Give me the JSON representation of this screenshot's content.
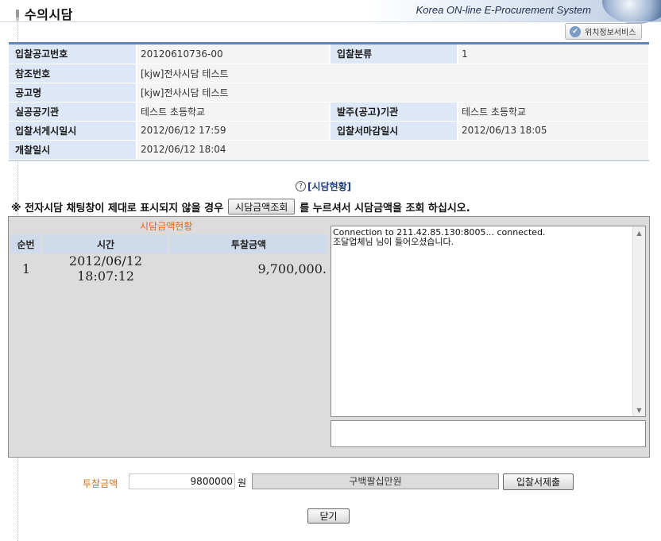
{
  "header": {
    "title": "수의시담",
    "brand": "Korea ON-line E-Procurement System",
    "location_button": "위치정보서비스"
  },
  "info": {
    "rows": [
      {
        "label1": "입찰공고번호",
        "value1": "20120610736-00",
        "label2": "입찰분류",
        "value2": "1"
      },
      {
        "label1": "참조번호",
        "value1": "[kjw]전사시담 테스트"
      },
      {
        "label1": "공고명",
        "value1": "[kjw]전사시담 테스트"
      },
      {
        "label1": "실공공기관",
        "value1": "테스트 초등학교",
        "label2": "발주(공고)기관",
        "value2": "테스트 초등학교"
      },
      {
        "label1": "입찰서게시일시",
        "value1": "2012/06/12 17:59",
        "label2": "입찰서마감일시",
        "value2": "2012/06/13 18:05"
      },
      {
        "label1": "개찰일시",
        "value1": "2012/06/12 18:04"
      }
    ]
  },
  "status_link": "[시담현황]",
  "notice": {
    "prefix": "※ 전자시담 채팅창이 제대로 표시되지 않을 경우",
    "button": "시담금액조회",
    "suffix": "를 누르셔서 시담금액을 조회 하십시오."
  },
  "bid_panel": {
    "caption": "시담금액현황",
    "columns": [
      "순번",
      "시간",
      "투찰금액"
    ],
    "rows": [
      {
        "seq": "1",
        "time": "2012/06/12 18:07:12",
        "amount": "9,700,000."
      }
    ]
  },
  "chat": {
    "lines": [
      "Connection to 211.42.85.130:8005... connected.",
      "조달업체님 님이 들어오셨습니다."
    ],
    "input": ""
  },
  "form": {
    "amount_label": "투찰금액",
    "amount_value": "9800000",
    "unit": "원",
    "korean_amount": "구백팔십만원",
    "submit_label": "입찰서제출",
    "close_label": "닫기"
  }
}
